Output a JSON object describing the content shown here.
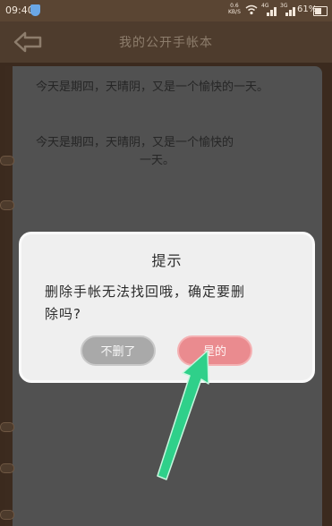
{
  "status_bar": {
    "time": "09:40",
    "speed_value": "0.6",
    "speed_unit": "KB/S",
    "sim1_tag": "4G",
    "sim2_tag": "3G",
    "battery": "61%"
  },
  "header": {
    "title": "我的公开手帐本",
    "back_icon": "back-arrow-icon"
  },
  "notebook": {
    "entries": [
      "今天是期四，天晴阴，又是一个愉快的一天。",
      "今天是期四，天晴阴，又是一个愉快的",
      "一天。"
    ]
  },
  "dialog": {
    "title": "提示",
    "message_line1": "删除手帐无法找回哦，确定要删",
    "message_line2": "除吗?",
    "cancel_label": "不删了",
    "confirm_label": "是的"
  },
  "colors": {
    "annotation_arrow": "#2fd08a",
    "confirm_button": "#ea8b8f",
    "cancel_button": "#a9a9a9"
  }
}
